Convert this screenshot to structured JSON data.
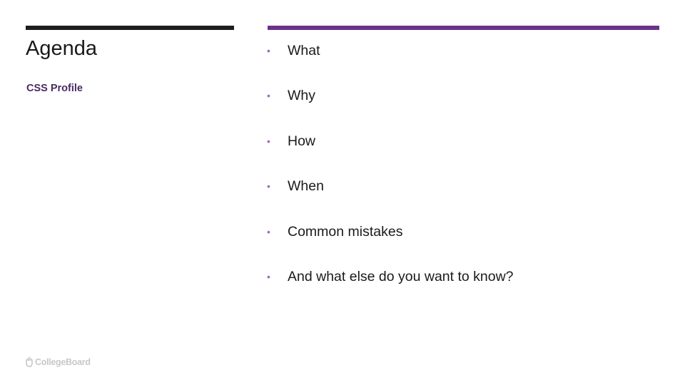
{
  "slide": {
    "title": "Agenda",
    "subtitle": "CSS Profile",
    "accent_color": "#6b3289",
    "bullets": [
      {
        "text": "What"
      },
      {
        "text": "Why"
      },
      {
        "text": "How"
      },
      {
        "text": "When"
      },
      {
        "text": "Common mistakes"
      },
      {
        "text": "And what else do you want to know?"
      }
    ],
    "bullet_glyph": "•",
    "footer_logo": {
      "icon": "acorn-icon",
      "text": "CollegeBoard"
    }
  }
}
